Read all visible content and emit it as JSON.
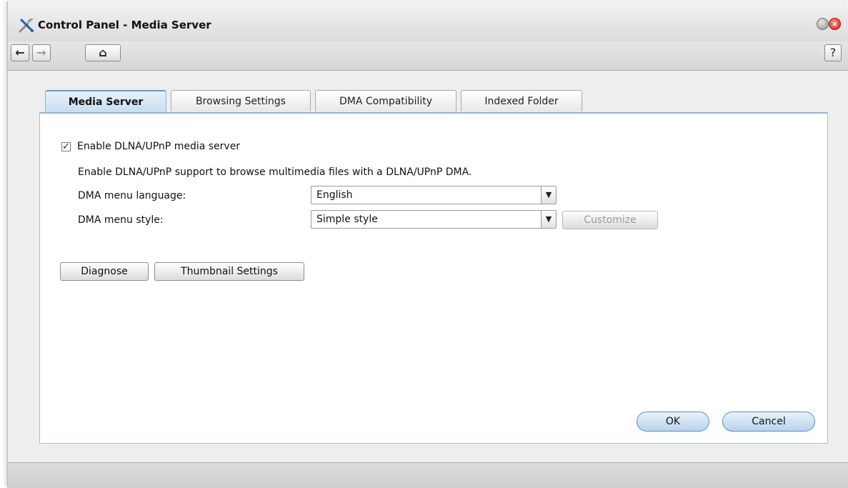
{
  "window": {
    "title": "Control Panel - Media Server",
    "app_icon": "wrench-screwdriver-icon",
    "controls": {
      "minimize": "minimize-icon",
      "close": "close-icon",
      "close_glyph": "×"
    }
  },
  "toolbar": {
    "back_glyph": "←",
    "forward_glyph": "→",
    "home_glyph": "⌂",
    "help_glyph": "?"
  },
  "tabs": [
    {
      "label": "Media Server",
      "active": true
    },
    {
      "label": "Browsing Settings",
      "active": false
    },
    {
      "label": "DMA Compatibility",
      "active": false
    },
    {
      "label": "Indexed Folder",
      "active": false
    }
  ],
  "media_server": {
    "enable_label": "Enable DLNA/UPnP media server",
    "enable_checked": true,
    "check_glyph": "✓",
    "description": "Enable DLNA/UPnP support to browse multimedia files with a DLNA/UPnP DMA.",
    "language_label": "DMA menu language:",
    "language_value": "English",
    "style_label": "DMA menu style:",
    "style_value": "Simple style",
    "dropdown_glyph": "▼",
    "customize_label": "Customize",
    "diagnose_label": "Diagnose",
    "thumbnail_label": "Thumbnail Settings"
  },
  "actions": {
    "ok_label": "OK",
    "cancel_label": "Cancel"
  },
  "colors": {
    "accent": "#6a9cc9",
    "close_red": "#d32015"
  }
}
